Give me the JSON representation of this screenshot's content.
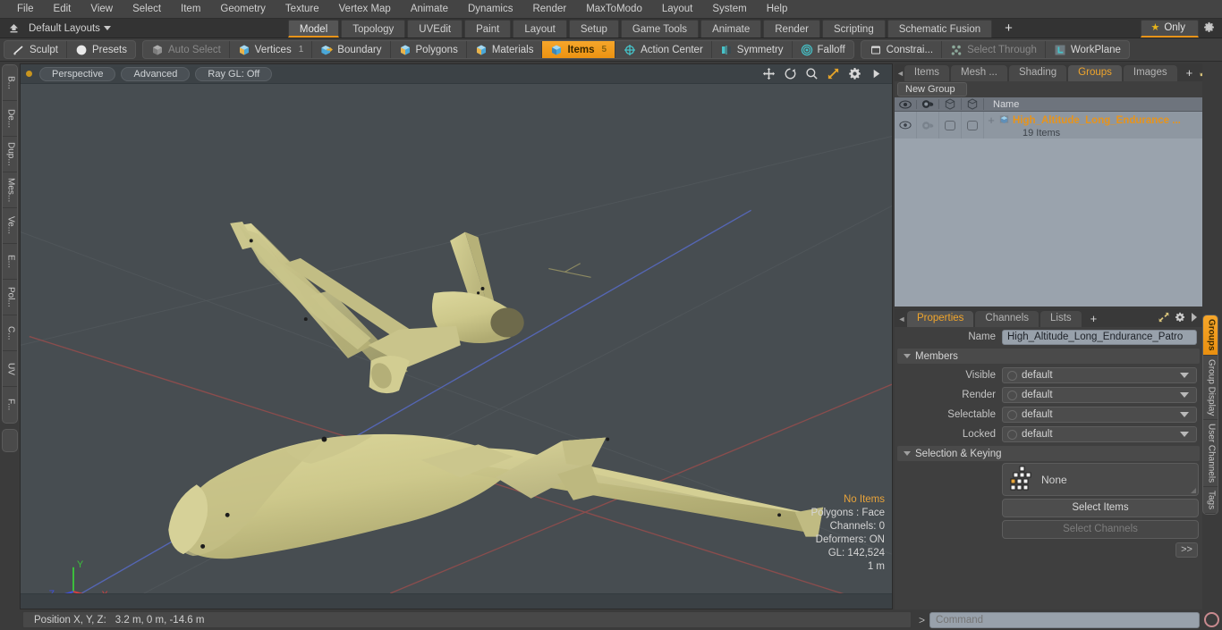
{
  "menubar": {
    "items": [
      "File",
      "Edit",
      "View",
      "Select",
      "Item",
      "Geometry",
      "Texture",
      "Vertex Map",
      "Animate",
      "Dynamics",
      "Render",
      "MaxToModo",
      "Layout",
      "System",
      "Help"
    ]
  },
  "layoutbar": {
    "home_icon": "home-up-icon",
    "layout_label": "Default Layouts",
    "tabs": [
      {
        "label": "Model",
        "active": true
      },
      {
        "label": "Topology",
        "active": false
      },
      {
        "label": "UVEdit",
        "active": false
      },
      {
        "label": "Paint",
        "active": false
      },
      {
        "label": "Layout",
        "active": false
      },
      {
        "label": "Setup",
        "active": false
      },
      {
        "label": "Game Tools",
        "active": false
      },
      {
        "label": "Animate",
        "active": false
      },
      {
        "label": "Render",
        "active": false
      },
      {
        "label": "Scripting",
        "active": false
      },
      {
        "label": "Schematic Fusion",
        "active": false
      }
    ],
    "add_tab_label": "+",
    "only_label": "Only",
    "only_icon": "star-icon",
    "settings_icon": "gear-icon"
  },
  "toolbar": {
    "group1": [
      {
        "label": "Sculpt",
        "icon": "sculpt-brush-icon",
        "state": "normal"
      },
      {
        "label": "Presets",
        "icon": "sphere-preset-icon",
        "state": "normal"
      }
    ],
    "group2": [
      {
        "label": "Auto Select",
        "icon": "cube-grey-icon",
        "state": "dim",
        "count": ""
      },
      {
        "label": "Vertices",
        "icon": "cube-blue-icon",
        "state": "normal",
        "count": "1"
      },
      {
        "label": "Boundary",
        "icon": "cube-arrow-icon",
        "state": "normal",
        "count": ""
      },
      {
        "label": "Polygons",
        "icon": "cube-blue-icon",
        "state": "normal",
        "count": ""
      },
      {
        "label": "Materials",
        "icon": "cube-blue-icon",
        "state": "normal",
        "count": ""
      },
      {
        "label": "Items",
        "icon": "cube-blue-icon",
        "state": "active",
        "count": "5"
      },
      {
        "label": "Action Center",
        "icon": "crosshair-icon",
        "state": "normal",
        "count": ""
      },
      {
        "label": "Symmetry",
        "icon": "symmetry-icon",
        "state": "normal",
        "count": ""
      },
      {
        "label": "Falloff",
        "icon": "falloff-icon",
        "state": "normal",
        "count": ""
      }
    ],
    "group3": [
      {
        "label": "Constrai...",
        "icon": "constrain-icon",
        "state": "normal"
      },
      {
        "label": "Select Through",
        "icon": "select-through-icon",
        "state": "dim"
      },
      {
        "label": "WorkPlane",
        "icon": "workplane-icon",
        "state": "normal"
      }
    ]
  },
  "left_rail": {
    "tabs": [
      "B...",
      "De...",
      "Dup...",
      "Mes...",
      "Ve...",
      "E...",
      "Pol...",
      "C...",
      "UV",
      "F..."
    ]
  },
  "viewport": {
    "header": {
      "buttons": [
        "Perspective",
        "Advanced",
        "Ray GL: Off"
      ],
      "icons": [
        "move-icon",
        "rotate-icon",
        "zoom-magnifier-icon",
        "fit-expand-icon",
        "gear-icon",
        "play-arrow-icon"
      ]
    },
    "stats": {
      "selection": "No Items",
      "polygons": "Polygons : Face",
      "channels": "Channels: 0",
      "deformers": "Deformers: ON",
      "gl": "GL: 142,524",
      "scale": "1 m"
    },
    "axis": {
      "x": "X",
      "y": "Y",
      "z": "Z"
    },
    "model_color": "#cfca8e",
    "background_color": "#474d51"
  },
  "right_panel": {
    "tabs": [
      {
        "label": "Items",
        "active": false
      },
      {
        "label": "Mesh ...",
        "active": false
      },
      {
        "label": "Shading",
        "active": false
      },
      {
        "label": "Groups",
        "active": true
      },
      {
        "label": "Images",
        "active": false
      }
    ],
    "add_tab_label": "+",
    "expand_icon": "expand-arrows-icon",
    "more_icon": "chevron-right-icon",
    "new_group_label": "New Group",
    "list": {
      "columns": [
        {
          "icon": "eye-icon"
        },
        {
          "icon": "render-camera-icon"
        },
        {
          "icon": "cube-outline-icon"
        },
        {
          "icon": "cube-outline-icon"
        },
        {
          "label": "Name"
        }
      ],
      "rows": [
        {
          "name": "High_Altitude_Long_Endurance ...",
          "sub": "19 Items",
          "expander": "+",
          "item_icon": "group-folder-icon"
        }
      ]
    }
  },
  "properties": {
    "tabs": [
      {
        "label": "Properties",
        "active": true
      },
      {
        "label": "Channels",
        "active": false
      },
      {
        "label": "Lists",
        "active": false
      }
    ],
    "add_tab_label": "+",
    "expand_icon": "expand-arrows-icon",
    "gear_icon": "gear-icon",
    "more_icon": "chevron-right-icon",
    "name_label": "Name",
    "name_value": "High_Altitude_Long_Endurance_Patro",
    "members_section": "Members",
    "fields": [
      {
        "label": "Visible",
        "value": "default"
      },
      {
        "label": "Render",
        "value": "default"
      },
      {
        "label": "Selectable",
        "value": "default"
      },
      {
        "label": "Locked",
        "value": "default"
      }
    ],
    "selection_section": "Selection & Keying",
    "selection_value": "None",
    "selection_icon": "hierarchy-tree-icon",
    "select_items_label": "Select Items",
    "select_channels_label": "Select Channels",
    "more_label": ">>"
  },
  "right_rail": {
    "tabs": [
      {
        "label": "Groups",
        "active": true
      },
      {
        "label": "Group Display",
        "active": false
      },
      {
        "label": "User Channels",
        "active": false
      },
      {
        "label": "Tags",
        "active": false
      }
    ]
  },
  "statusbar": {
    "position_label": "Position X, Y, Z:",
    "position_value": "3.2 m, 0 m, -14.6 m",
    "prompt": ">",
    "command_placeholder": "Command",
    "record_icon": "record-circle-icon"
  }
}
